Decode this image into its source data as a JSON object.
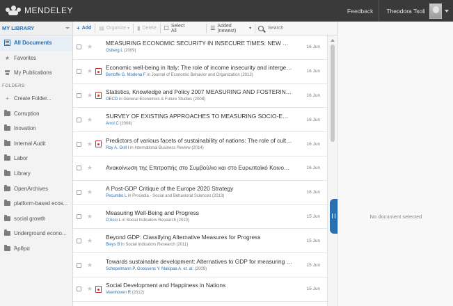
{
  "topbar": {
    "brand": "MENDELEY",
    "feedback": "Feedback",
    "user": "Theodora Tsoli"
  },
  "sidebar": {
    "title": "MY LIBRARY",
    "items": [
      {
        "label": "All Documents",
        "icon": "documents-icon",
        "active": true
      },
      {
        "label": "Favorites",
        "icon": "star-icon"
      },
      {
        "label": "My Publications",
        "icon": "publications-icon"
      }
    ],
    "folders_label": "FOLDERS",
    "create_folder": "Create Folder...",
    "folders": [
      "Corruption",
      "Inovation",
      "Internal Audit",
      "Labor",
      "Library",
      "OpenArchives",
      "platform-based ecos...",
      "social growth",
      "Underground econo...",
      "Άρθρα"
    ]
  },
  "toolbar": {
    "add": "Add",
    "organize": "Organize",
    "delete": "Delete",
    "select_all": "Select All",
    "sort": "Added (newest)",
    "search_placeholder": "Search"
  },
  "documents": [
    {
      "title": "MEASURING ECONOMIC SECURITY IN INSECURE TIMES: NEW PERSPECT...",
      "authors": "Osberg L",
      "meta": " (2009)",
      "date": "16 Jun",
      "pdf": false
    },
    {
      "title": "Economic well-being in Italy: The role of income insecurity and intergenerational...",
      "authors": "Bertoffe G. Modena F",
      "meta": " in Journal of Economic Behavior and Organization (2012)",
      "date": "16 Jun",
      "pdf": true
    },
    {
      "title": "Statistics, Knowledge and Policy 2007 MEASURING AND FOSTERING THE P...",
      "authors": "OECD",
      "meta": " in General Economics & Future Studies (2008)",
      "date": "16 Jun",
      "pdf": true
    },
    {
      "title": "SURVEY OF EXISTING APPROACHES TO MEASURING SOCIO-ECONOMIC...",
      "authors": "Arrol C",
      "meta": " (2008)",
      "date": "16 Jun",
      "pdf": false
    },
    {
      "title": "Predictors of various facets of sustainability of nations: The role of cultural and ...",
      "authors": "Roy A. Goll I",
      "meta": " in International Business Review (2014)",
      "date": "16 Jun",
      "pdf": true
    },
    {
      "title": "Ανακοίνωση της Επιτροπής στο Συμβούλιο και στο Ευρωπαϊκό Κοινοβούλιο - Α...",
      "authors": "",
      "meta": "",
      "date": "16 Jun",
      "pdf": false
    },
    {
      "title": "A Post-GDP Critique of the Europe 2020 Strategy",
      "authors": "Pecumbo L",
      "meta": " in Procedia - Social and Behavioral Sciences (2013)",
      "date": "16 Jun",
      "pdf": false
    },
    {
      "title": "Measuring Well-Being and Progress",
      "authors": "D'Acci L",
      "meta": " in Social Indicators Research (2010)",
      "date": "15 Jun",
      "pdf": false
    },
    {
      "title": "Beyond GDP: Classifying Alternative Measures for Progress",
      "authors": "Bleys B",
      "meta": " in Social Indicators Research (2011)",
      "date": "15 Jun",
      "pdf": false
    },
    {
      "title": "Towards sustainable development: Alternatives to GDP for measuring progress",
      "authors": "Schepelmann P. Goossens Y. Makipaa A. et. al.",
      "meta": " (2009)",
      "date": "15 Jun",
      "pdf": false
    },
    {
      "title": "Social Development and Happiness in Nations",
      "authors": "Veenhoven R",
      "meta": " (2012)",
      "date": "15 Jun",
      "pdf": true
    }
  ],
  "details": {
    "empty_text": "No document selected"
  },
  "colors": {
    "accent": "#2a6fb0",
    "topbar": "#3a3a3a"
  }
}
